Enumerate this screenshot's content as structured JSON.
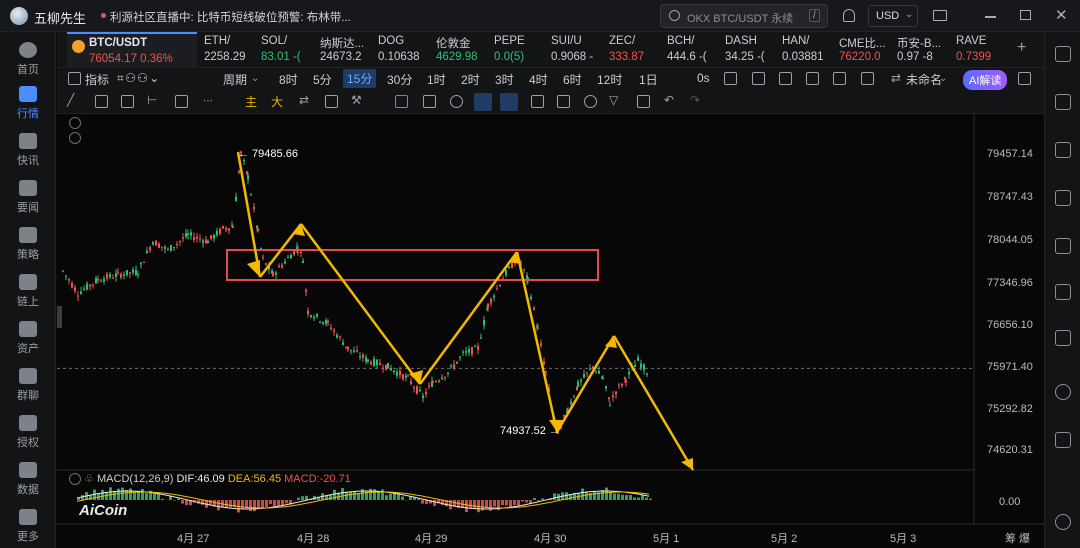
{
  "app": {
    "name": "五柳先生",
    "news": "利源社区直播中: 比特币短线破位预警: 布林带...",
    "search_placeholder": "OKX BTC/USDT 永续",
    "search_key": "/",
    "currency": "USD"
  },
  "nav": [
    {
      "label": "首页"
    },
    {
      "label": "行情",
      "active": true
    },
    {
      "label": "快讯"
    },
    {
      "label": "要闻"
    },
    {
      "label": "策略"
    },
    {
      "label": "链上"
    },
    {
      "label": "资产"
    },
    {
      "label": "群聊"
    },
    {
      "label": "授权"
    },
    {
      "label": "数据"
    },
    {
      "label": "更多"
    }
  ],
  "tickers": [
    {
      "name": "BTC/USDT",
      "price": "76054.17",
      "change": "0.36%",
      "dir": "down"
    },
    {
      "name": "ETH/",
      "price": "2258.29",
      "dir": "up"
    },
    {
      "name": "SOL/",
      "price": "83.01 -(",
      "dir": "up"
    },
    {
      "name": "纳斯达...",
      "price": "24673.2",
      "dir": "neutral"
    },
    {
      "name": "DOG",
      "price": "0.10638",
      "dir": "neutral"
    },
    {
      "name": "伦敦金",
      "price": "4629.98",
      "dir": "up"
    },
    {
      "name": "PEPE",
      "price": "0.0(5)",
      "dir": "up"
    },
    {
      "name": "SUI/U",
      "price": "0.9068 -",
      "dir": "neutral"
    },
    {
      "name": "ZEC/",
      "price": "333.87",
      "dir": "down"
    },
    {
      "name": "BCH/",
      "price": "444.6 -(",
      "dir": "neutral"
    },
    {
      "name": "DASH",
      "price": "34.25 -(",
      "dir": "neutral"
    },
    {
      "name": "HAN/",
      "price": "0.03881",
      "dir": "neutral"
    },
    {
      "name": "CME比...",
      "price": "76220.0",
      "dir": "down"
    },
    {
      "name": "币安-B...",
      "price": "0.97 -8",
      "dir": "neutral"
    },
    {
      "name": "RAVE",
      "price": "0.7399",
      "dir": "down"
    }
  ],
  "toolbar": {
    "indicator": "指标",
    "period": "周期",
    "intervals": [
      "8时",
      "5分",
      "15分",
      "30分",
      "1时",
      "2时",
      "3时",
      "4时",
      "6时",
      "12时",
      "1日"
    ],
    "selected": "15分",
    "zero_s": "0s",
    "layout_name": "未命名",
    "ai": "AI解读"
  },
  "drawbar": {
    "main": "主",
    "big": "大",
    "arrow": "⇄"
  },
  "chart_data": {
    "type": "candlestick",
    "symbol": "BTC/USDT",
    "yticks": [
      79457.14,
      78747.43,
      78044.05,
      77346.96,
      76656.1,
      75971.4,
      75292.82,
      74620.31
    ],
    "xticks": [
      "4月 27",
      "4月 28",
      "4月 29",
      "4月 30",
      "5月 1",
      "5月 2",
      "5月 3"
    ],
    "annotations": [
      {
        "label": "← 79485.66",
        "value": 79485.66
      },
      {
        "label": "74937.52 →",
        "value": 74937.52
      }
    ],
    "current_price": 75971.4,
    "macd": {
      "label": "MACD(12,26,9)",
      "dif": "DIF:46.09",
      "dea": "DEA:56.45",
      "macd": "MACD:-20.71",
      "zero": "0.00"
    },
    "watermark": "AiCoin"
  },
  "colors": {
    "up": "#2fbf71",
    "down": "#ef5350",
    "accent": "#4d8bff",
    "arrows": "#f5b800",
    "box": "#e5484d"
  }
}
